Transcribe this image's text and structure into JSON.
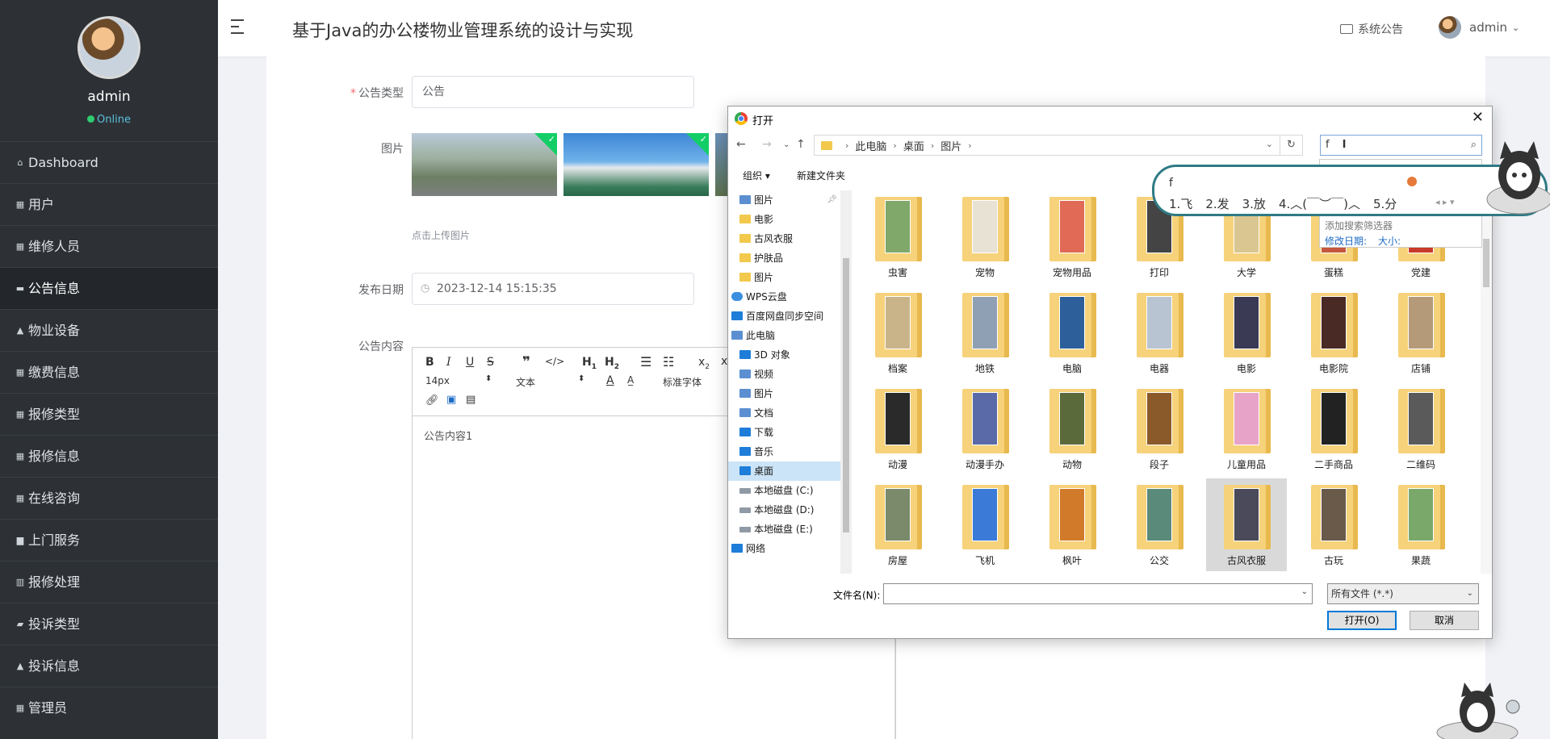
{
  "sidebar": {
    "username": "admin",
    "status": "Online",
    "items": [
      {
        "label": "Dashboard",
        "icon": "home-icon"
      },
      {
        "label": "用户",
        "icon": "grid-icon"
      },
      {
        "label": "维修人员",
        "icon": "grid-icon"
      },
      {
        "label": "公告信息",
        "icon": "file-icon"
      },
      {
        "label": "物业设备",
        "icon": "person-icon"
      },
      {
        "label": "缴费信息",
        "icon": "grid-icon"
      },
      {
        "label": "报修类型",
        "icon": "grid-icon"
      },
      {
        "label": "报修信息",
        "icon": "table-icon"
      },
      {
        "label": "在线咨询",
        "icon": "grid-icon"
      },
      {
        "label": "上门服务",
        "icon": "briefcase-icon"
      },
      {
        "label": "报修处理",
        "icon": "bar-chart-icon"
      },
      {
        "label": "投诉类型",
        "icon": "thumbs-up-icon"
      },
      {
        "label": "投诉信息",
        "icon": "person-icon"
      },
      {
        "label": "管理员",
        "icon": "grid-icon"
      }
    ],
    "active_index": 3
  },
  "header": {
    "title": "基于Java的办公楼物业管理系统的设计与实现",
    "notice": "系统公告",
    "user": "admin"
  },
  "form": {
    "type_label": "公告类型",
    "type_value": "公告",
    "image_label": "图片",
    "upload_tip": "点击上传图片",
    "date_label": "发布日期",
    "date_value": "2023-12-14 15:15:35",
    "content_label": "公告内容",
    "content_value": "公告内容1",
    "editor": {
      "font_size": "14px",
      "paragraph": "文本",
      "font_family": "标准字体"
    }
  },
  "dialog": {
    "title": "打开",
    "breadcrumb": [
      "此电脑",
      "桌面",
      "图片"
    ],
    "search_value": "f",
    "organize": "组织 ▾",
    "new_folder": "新建文件夹",
    "nav_items": [
      {
        "label": "图片",
        "icon": "image-icon",
        "pinned": true
      },
      {
        "label": "电影",
        "icon": "folder-icon"
      },
      {
        "label": "古风衣服",
        "icon": "folder-icon"
      },
      {
        "label": "护肤品",
        "icon": "folder-icon"
      },
      {
        "label": "图片",
        "icon": "folder-icon"
      },
      {
        "label": "WPS云盘",
        "icon": "cloud-icon",
        "level": 0
      },
      {
        "label": "百度网盘同步空间",
        "icon": "baidu-icon",
        "level": 0
      },
      {
        "label": "此电脑",
        "icon": "pc-icon",
        "level": 0
      },
      {
        "label": "3D 对象",
        "icon": "cube-icon"
      },
      {
        "label": "视频",
        "icon": "video-icon"
      },
      {
        "label": "图片",
        "icon": "image-icon"
      },
      {
        "label": "文档",
        "icon": "document-icon"
      },
      {
        "label": "下载",
        "icon": "download-icon"
      },
      {
        "label": "音乐",
        "icon": "music-icon"
      },
      {
        "label": "桌面",
        "icon": "desktop-icon",
        "selected": true
      },
      {
        "label": "本地磁盘 (C:)",
        "icon": "drive-icon"
      },
      {
        "label": "本地磁盘 (D:)",
        "icon": "drive-icon"
      },
      {
        "label": "本地磁盘 (E:)",
        "icon": "drive-icon"
      },
      {
        "label": "网络",
        "icon": "network-icon",
        "level": 0
      }
    ],
    "folders": [
      "虫害",
      "宠物",
      "宠物用品",
      "打印",
      "大学",
      "蛋糕",
      "党建",
      "档案",
      "地铁",
      "电脑",
      "电器",
      "电影",
      "电影院",
      "店铺",
      "动漫",
      "动漫手办",
      "动物",
      "段子",
      "儿童用品",
      "二手商品",
      "二维码",
      "房屋",
      "飞机",
      "枫叶",
      "公交",
      "古风衣服",
      "古玩",
      "果蔬"
    ],
    "selected_folder": "古风衣服",
    "filename_label": "文件名(N):",
    "filename_value": "",
    "filetype": "所有文件 (*.*)",
    "open_button": "打开(O)",
    "cancel_button": "取消",
    "search_dropdown": {
      "add_filter": "添加搜索筛选器",
      "modified": "修改日期:",
      "size": "大小:"
    }
  },
  "ime": {
    "composition": "f",
    "candidates": [
      "1.飞",
      "2.发",
      "3.放",
      "4.︿(￣︶￣)︿",
      "5.分"
    ]
  }
}
